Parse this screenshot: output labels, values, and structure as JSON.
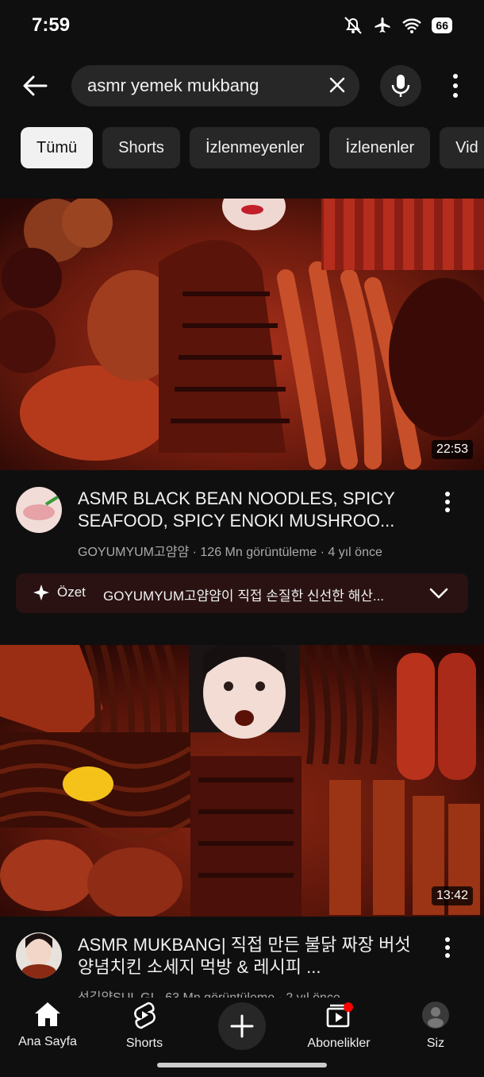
{
  "status": {
    "time": "7:59",
    "battery": "66"
  },
  "search": {
    "query": "asmr yemek mukbang"
  },
  "chips": [
    "Tümü",
    "Shorts",
    "İzlenmeyenler",
    "İzlenenler",
    "Vid"
  ],
  "videos": [
    {
      "title": "ASMR BLACK BEAN NOODLES, SPICY SEAFOOD, SPICY ENOKI MUSHROO...",
      "channel": "GOYUMYUM고얌얌",
      "views": "126 Mn görüntüleme",
      "age": "4 yıl önce",
      "duration": "22:53"
    },
    {
      "title": "ASMR MUKBANG| 직접 만든 불닭 짜장 버섯 양념치킨 소세지 먹방 & 레시피 ...",
      "channel": "선길얌SUL GI",
      "views": "63 Mn görüntüleme",
      "age": "2 yıl önce",
      "duration": "13:42"
    }
  ],
  "summary": {
    "label": "Özet",
    "text": "GOYUMYUM고얌얌이 직접 손질한 신선한 해산..."
  },
  "nav": {
    "home": "Ana Sayfa",
    "shorts": "Shorts",
    "subs": "Abonelikler",
    "you": "Siz"
  },
  "colors": {
    "background": "#0f0f0f",
    "chip_active": "#f1f1f1",
    "summary_bg": "#2a1212",
    "notification_dot": "#ff0000"
  }
}
